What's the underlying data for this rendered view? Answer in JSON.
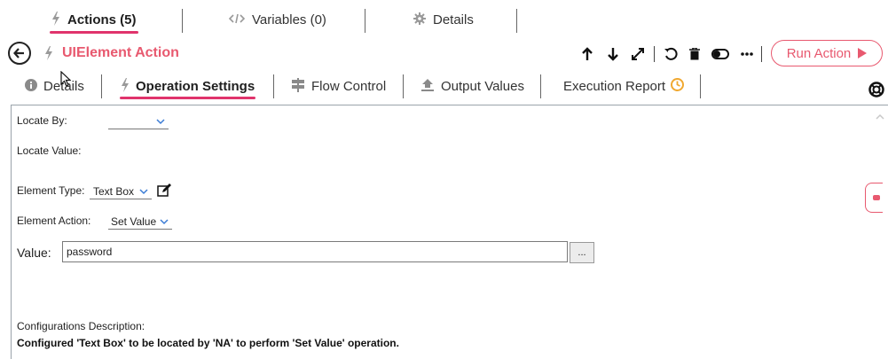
{
  "top_tabs": [
    {
      "label": "Actions (5)",
      "icon": "bolt-icon",
      "active": true
    },
    {
      "label": "Variables (0)",
      "icon": "code-icon",
      "active": false
    },
    {
      "label": "Details",
      "icon": "gear-icon",
      "active": false
    }
  ],
  "header": {
    "title": "UIElement Action",
    "run_button_label": "Run Action",
    "toolbar_icons": [
      "arrow-up-icon",
      "arrow-down-icon",
      "expand-icon",
      "undo-icon",
      "trash-icon",
      "toggle-icon",
      "more-icon"
    ]
  },
  "sub_tabs": [
    {
      "label": "Details",
      "icon": "info-icon",
      "active": false
    },
    {
      "label": "Operation Settings",
      "icon": "bolt-icon",
      "active": true
    },
    {
      "label": "Flow Control",
      "icon": "signpost-icon",
      "active": false
    },
    {
      "label": "Output Values",
      "icon": "upload-icon",
      "active": false
    },
    {
      "label": "Execution Report",
      "icon": "clock-icon",
      "active": false
    }
  ],
  "form": {
    "locate_by_label": "Locate By:",
    "locate_by_value": "",
    "locate_value_label": "Locate Value:",
    "element_type_label": "Element Type:",
    "element_type_value": "Text Box",
    "element_action_label": "Element Action:",
    "element_action_value": "Set Value",
    "value_label": "Value:",
    "value": "password",
    "browse_button_label": "...",
    "config_desc_label": "Configurations Description:",
    "config_desc_text": "Configured 'Text Box' to be located by 'NA' to perform 'Set Value' operation."
  },
  "colors": {
    "accent": "#e0336c",
    "title": "#e8596f",
    "clock": "#f0a830"
  }
}
